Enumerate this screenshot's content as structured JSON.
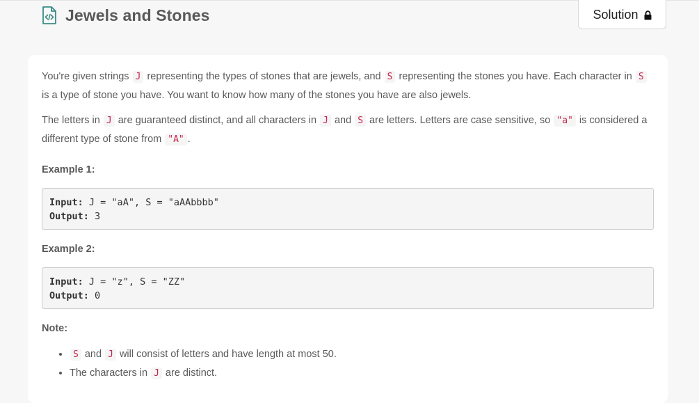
{
  "problem": {
    "title": "Jewels and Stones",
    "icon": "code-file-icon",
    "solution_label": "Solution",
    "solution_icon": "lock-icon",
    "accent_color": "#3a8c85"
  },
  "description": {
    "p1": {
      "t1": "You're given strings",
      "c1": "J",
      "t2": "representing the types of stones that are jewels, and",
      "c2": "S",
      "t3": "representing the stones you have.  Each character in",
      "c3": "S",
      "t4": "is a type of stone you have.  You want to know how many of the stones you have are also jewels."
    },
    "p2": {
      "t1": "The letters in",
      "c1": "J",
      "t2": "are guaranteed distinct, and all characters in",
      "c2": "J",
      "t3": "and",
      "c3": "S",
      "t4": "are letters. Letters are case sensitive, so",
      "c4": "\"a\"",
      "t5": "is considered a different type of stone from",
      "c5": "\"A\"",
      "t6": "."
    }
  },
  "examples": [
    {
      "label": "Example 1:",
      "input_key": "Input:",
      "input_value": "J = \"aA\", S = \"aAAbbbb\"",
      "output_key": "Output:",
      "output_value": "3"
    },
    {
      "label": "Example 2:",
      "input_key": "Input:",
      "input_value": "J = \"z\", S = \"ZZ\"",
      "output_key": "Output:",
      "output_value": "0"
    }
  ],
  "note": {
    "label": "Note:",
    "items": [
      {
        "c1": "S",
        "t1": "and",
        "c2": "J",
        "t2": "will consist of letters and have length at most 50."
      },
      {
        "t1": "The characters in",
        "c1": "J",
        "t2": "are distinct."
      }
    ]
  }
}
